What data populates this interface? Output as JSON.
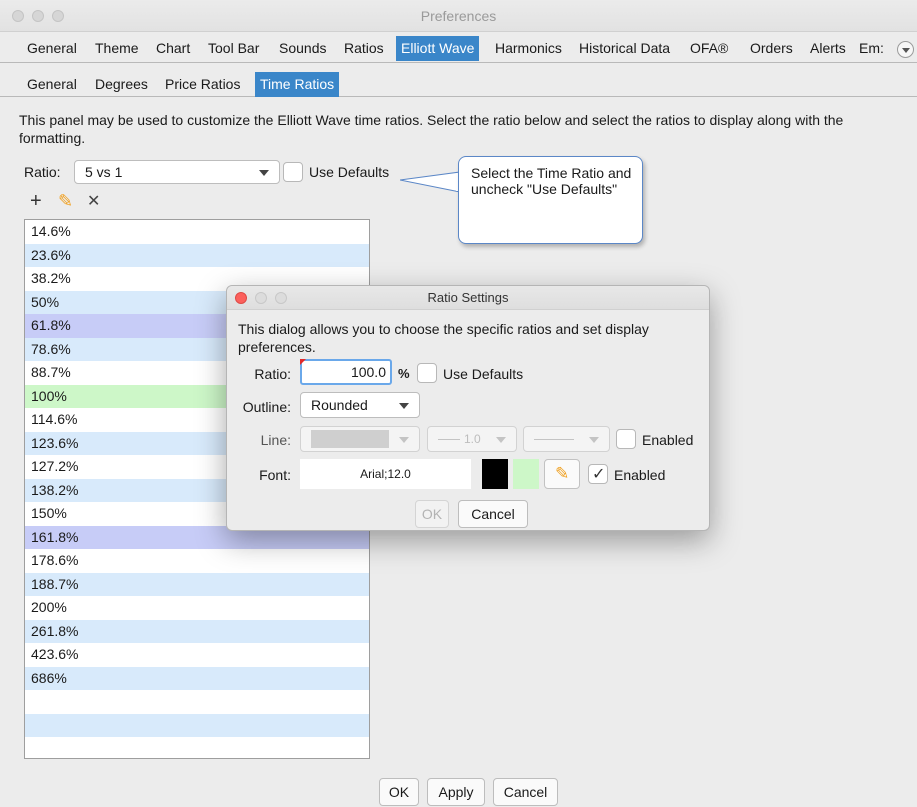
{
  "window": {
    "title": "Preferences"
  },
  "main_tabs": [
    {
      "label": "General"
    },
    {
      "label": "Theme"
    },
    {
      "label": "Chart"
    },
    {
      "label": "Tool Bar"
    },
    {
      "label": "Sounds"
    },
    {
      "label": "Ratios"
    },
    {
      "label": "Elliott Wave",
      "active": true
    },
    {
      "label": "Harmonics"
    },
    {
      "label": "Historical Data"
    },
    {
      "label": "OFA®"
    },
    {
      "label": "Orders"
    },
    {
      "label": "Alerts"
    },
    {
      "label": "Em:"
    }
  ],
  "sub_tabs": [
    {
      "label": "General"
    },
    {
      "label": "Degrees"
    },
    {
      "label": "Price Ratios"
    },
    {
      "label": "Time Ratios",
      "active": true
    }
  ],
  "description": "This panel may be used to customize the Elliott Wave time ratios.  Select the ratio below and select the ratios to display along with the formatting.",
  "ratio_selector": {
    "label": "Ratio:",
    "value": "5 vs 1",
    "use_defaults_label": "Use Defaults",
    "use_defaults_checked": false
  },
  "toolbar": {
    "add": "+",
    "edit": "✎",
    "delete": "✕"
  },
  "ratios": [
    {
      "label": "14.6%",
      "bg": "#ffffff"
    },
    {
      "label": "23.6%",
      "bg": "#d8eafb"
    },
    {
      "label": "38.2%",
      "bg": "#ffffff"
    },
    {
      "label": "50%",
      "bg": "#d8eafb"
    },
    {
      "label": "61.8%",
      "bg": "#c7ccf7"
    },
    {
      "label": "78.6%",
      "bg": "#d8eafb"
    },
    {
      "label": "88.7%",
      "bg": "#ffffff"
    },
    {
      "label": "100%",
      "bg": "#cdf7c8"
    },
    {
      "label": "114.6%",
      "bg": "#ffffff"
    },
    {
      "label": "123.6%",
      "bg": "#d8eafb"
    },
    {
      "label": "127.2%",
      "bg": "#ffffff"
    },
    {
      "label": "138.2%",
      "bg": "#d8eafb"
    },
    {
      "label": "150%",
      "bg": "#ffffff"
    },
    {
      "label": "161.8%",
      "bg": "#c7ccf7"
    },
    {
      "label": "178.6%",
      "bg": "#ffffff"
    },
    {
      "label": "188.7%",
      "bg": "#d8eafb"
    },
    {
      "label": "200%",
      "bg": "#ffffff"
    },
    {
      "label": "261.8%",
      "bg": "#d8eafb"
    },
    {
      "label": "423.6%",
      "bg": "#ffffff"
    },
    {
      "label": "686%",
      "bg": "#d8eafb"
    },
    {
      "label": "",
      "bg": "#ffffff"
    },
    {
      "label": "",
      "bg": "#d8eafb"
    },
    {
      "label": "",
      "bg": "#ffffff"
    }
  ],
  "callout": {
    "text": "Select the Time Ratio and uncheck \"Use Defaults\""
  },
  "dialog": {
    "title": "Ratio Settings",
    "description": "This dialog allows you to choose the specific ratios and set display preferences.",
    "ratio_label": "Ratio:",
    "ratio_value": "100.0",
    "percent": "%",
    "use_defaults_label": "Use Defaults",
    "outline_label": "Outline:",
    "outline_value": "Rounded",
    "line_label": "Line:",
    "line_width": "1.0",
    "line_enabled_label": "Enabled",
    "font_label": "Font:",
    "font_value": "Arial;12.0",
    "font_color": "#000000",
    "font_bg_color": "#cdf7c8",
    "font_enabled_label": "Enabled",
    "font_enabled_checked": true,
    "ok": "OK",
    "cancel": "Cancel"
  },
  "footer": {
    "ok": "OK",
    "apply": "Apply",
    "cancel": "Cancel"
  },
  "colors": {
    "accent": "#3a86c9",
    "callout_border": "#5b87c7",
    "close_red": "#fc605c"
  }
}
